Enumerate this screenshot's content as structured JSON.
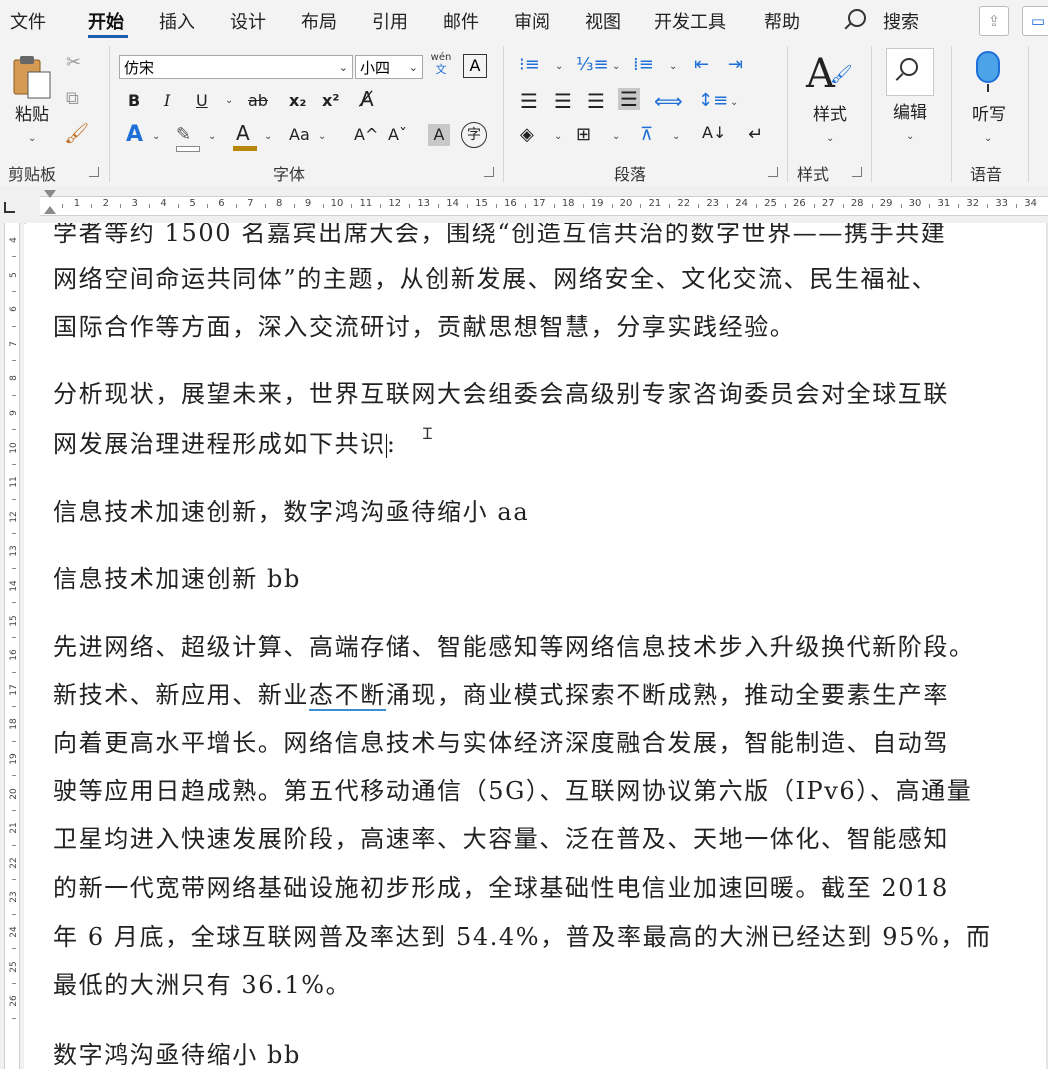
{
  "menu": {
    "tabs": [
      {
        "label": "文件",
        "active": false
      },
      {
        "label": "开始",
        "active": true
      },
      {
        "label": "插入",
        "active": false
      },
      {
        "label": "设计",
        "active": false
      },
      {
        "label": "布局",
        "active": false
      },
      {
        "label": "引用",
        "active": false
      },
      {
        "label": "邮件",
        "active": false
      },
      {
        "label": "审阅",
        "active": false
      },
      {
        "label": "视图",
        "active": false
      },
      {
        "label": "开发工具",
        "active": false
      },
      {
        "label": "帮助",
        "active": false
      }
    ],
    "search_label": "搜索"
  },
  "ribbon": {
    "clipboard": {
      "paste_label": "粘贴",
      "group_label": "剪贴板"
    },
    "font": {
      "font_name": "仿宋",
      "font_size": "小四",
      "phonetic_top": "wén",
      "phonetic_bottom": "文",
      "group_label": "字体",
      "bold": "B",
      "italic": "I",
      "underline": "U",
      "strike": "ab",
      "subscript": "x₂",
      "superscript": "x²",
      "text_effect": "A",
      "font_color": "A",
      "change_case": "Aa",
      "grow": "A^",
      "shrink": "Aˇ",
      "char_shade": "A",
      "enclose": "字",
      "char_border": "A"
    },
    "paragraph": {
      "group_label": "段落"
    },
    "styles": {
      "button_label": "样式",
      "group_label": "样式"
    },
    "editing": {
      "button_label": "编辑"
    },
    "voice": {
      "button_label": "听写",
      "group_label": "语音"
    }
  },
  "ruler": {
    "h_numbers": [
      "1",
      "2",
      "3",
      "4",
      "5",
      "6",
      "7",
      "8",
      "9",
      "10",
      "11",
      "12",
      "13",
      "14",
      "15",
      "16",
      "17",
      "18",
      "19",
      "20",
      "21",
      "22",
      "23",
      "24",
      "25",
      "26",
      "27",
      "28",
      "29",
      "30",
      "31",
      "32",
      "33",
      "34"
    ],
    "v_numbers": [
      "4",
      "5",
      "6",
      "7",
      "8",
      "9",
      "10",
      "11",
      "12",
      "13",
      "14",
      "15",
      "16",
      "17",
      "18",
      "19",
      "20",
      "21",
      "22",
      "23",
      "24",
      "25",
      "26"
    ]
  },
  "document": {
    "lines": {
      "p1_l1": "学者等约 1500 名嘉宾出席大会，围绕“创造互信共治的数字世界——携手共建",
      "p1_l2": "网络空间命运共同体”的主题，从创新发展、网络安全、文化交流、民生福祉、",
      "p1_l3": "国际合作等方面，深入交流研讨，贡献思想智慧，分享实践经验。",
      "p2_l1": "分析现状，展望未来，世界互联网大会组委会高级别专家咨询委员会对全球互联",
      "p2_l2": "网发展治理进程形成如下共识",
      "p2_l2_end": ":",
      "p3": "信息技术加速创新，数字鸿沟亟待缩小 aa",
      "p4": "信息技术加速创新 bb",
      "p5_l1": "先进网络、超级计算、高端存储、智能感知等网络信息技术步入升级换代新阶段。",
      "p5_l2a": "新技术、新应用、新业",
      "p5_l2b": "态不断",
      "p5_l2c": "涌现，商业模式探索不断成熟，推动全要素生产率",
      "p5_l3": "向着更高水平增长。网络信息技术与实体经济深度融合发展，智能制造、自动驾",
      "p5_l4": "驶等应用日趋成熟。第五代移动通信（5G）、互联网协议第六版（IPv6）、高通量",
      "p5_l5": "卫星均进入快速发展阶段，高速率、大容量、泛在普及、天地一体化、智能感知",
      "p5_l6": "的新一代宽带网络基础设施初步形成，全球基础性电信业加速回暖。截至 2018",
      "p5_l7": "年 6 月底，全球互联网普及率达到 54.4%，普及率最高的大洲已经达到 95%，而",
      "p5_l8": "最低的大洲只有 36.1%。",
      "p6": "数字鸿沟亟待缩小 bb"
    }
  }
}
